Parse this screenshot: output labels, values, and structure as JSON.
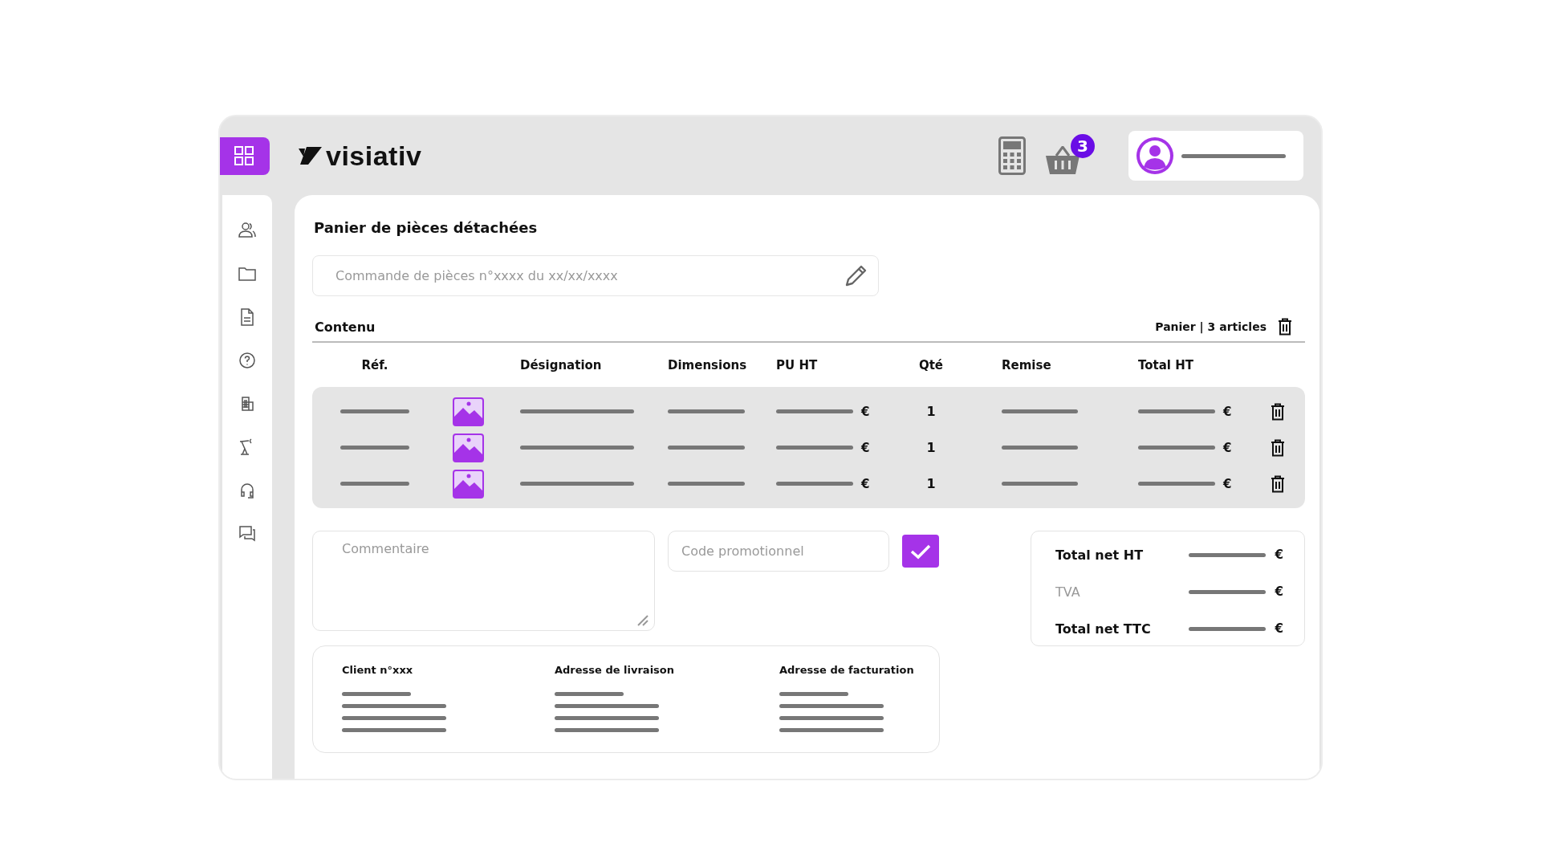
{
  "header": {
    "logo": "visiativ",
    "cart_badge": "3"
  },
  "page": {
    "title": "Panier de pièces détachées",
    "order_field": {
      "placeholder": "Commande de pièces n°xxxx du xx/xx/xxxx"
    },
    "section": "Contenu",
    "cart_summary": "Panier | 3 articles"
  },
  "table": {
    "columns": [
      "Réf.",
      "Désignation",
      "Dimensions",
      "PU HT",
      "Qté",
      "Remise",
      "Total HT"
    ],
    "rows": [
      {
        "qty": "1",
        "pu_currency": "€",
        "total_currency": "€"
      },
      {
        "qty": "1",
        "pu_currency": "€",
        "total_currency": "€"
      },
      {
        "qty": "1",
        "pu_currency": "€",
        "total_currency": "€"
      }
    ]
  },
  "comment": {
    "placeholder": "Commentaire"
  },
  "promo": {
    "placeholder": "Code promotionnel"
  },
  "totals": [
    {
      "label": "Total net HT",
      "kind": "bold",
      "currency": "€"
    },
    {
      "label": "TVA",
      "kind": "muted",
      "currency": "€"
    },
    {
      "label": "Total net TTC",
      "kind": "bold",
      "currency": "€"
    }
  ],
  "addresses": [
    {
      "title": "Client n°xxx"
    },
    {
      "title": "Adresse de livraison"
    },
    {
      "title": "Adresse de facturation"
    }
  ]
}
